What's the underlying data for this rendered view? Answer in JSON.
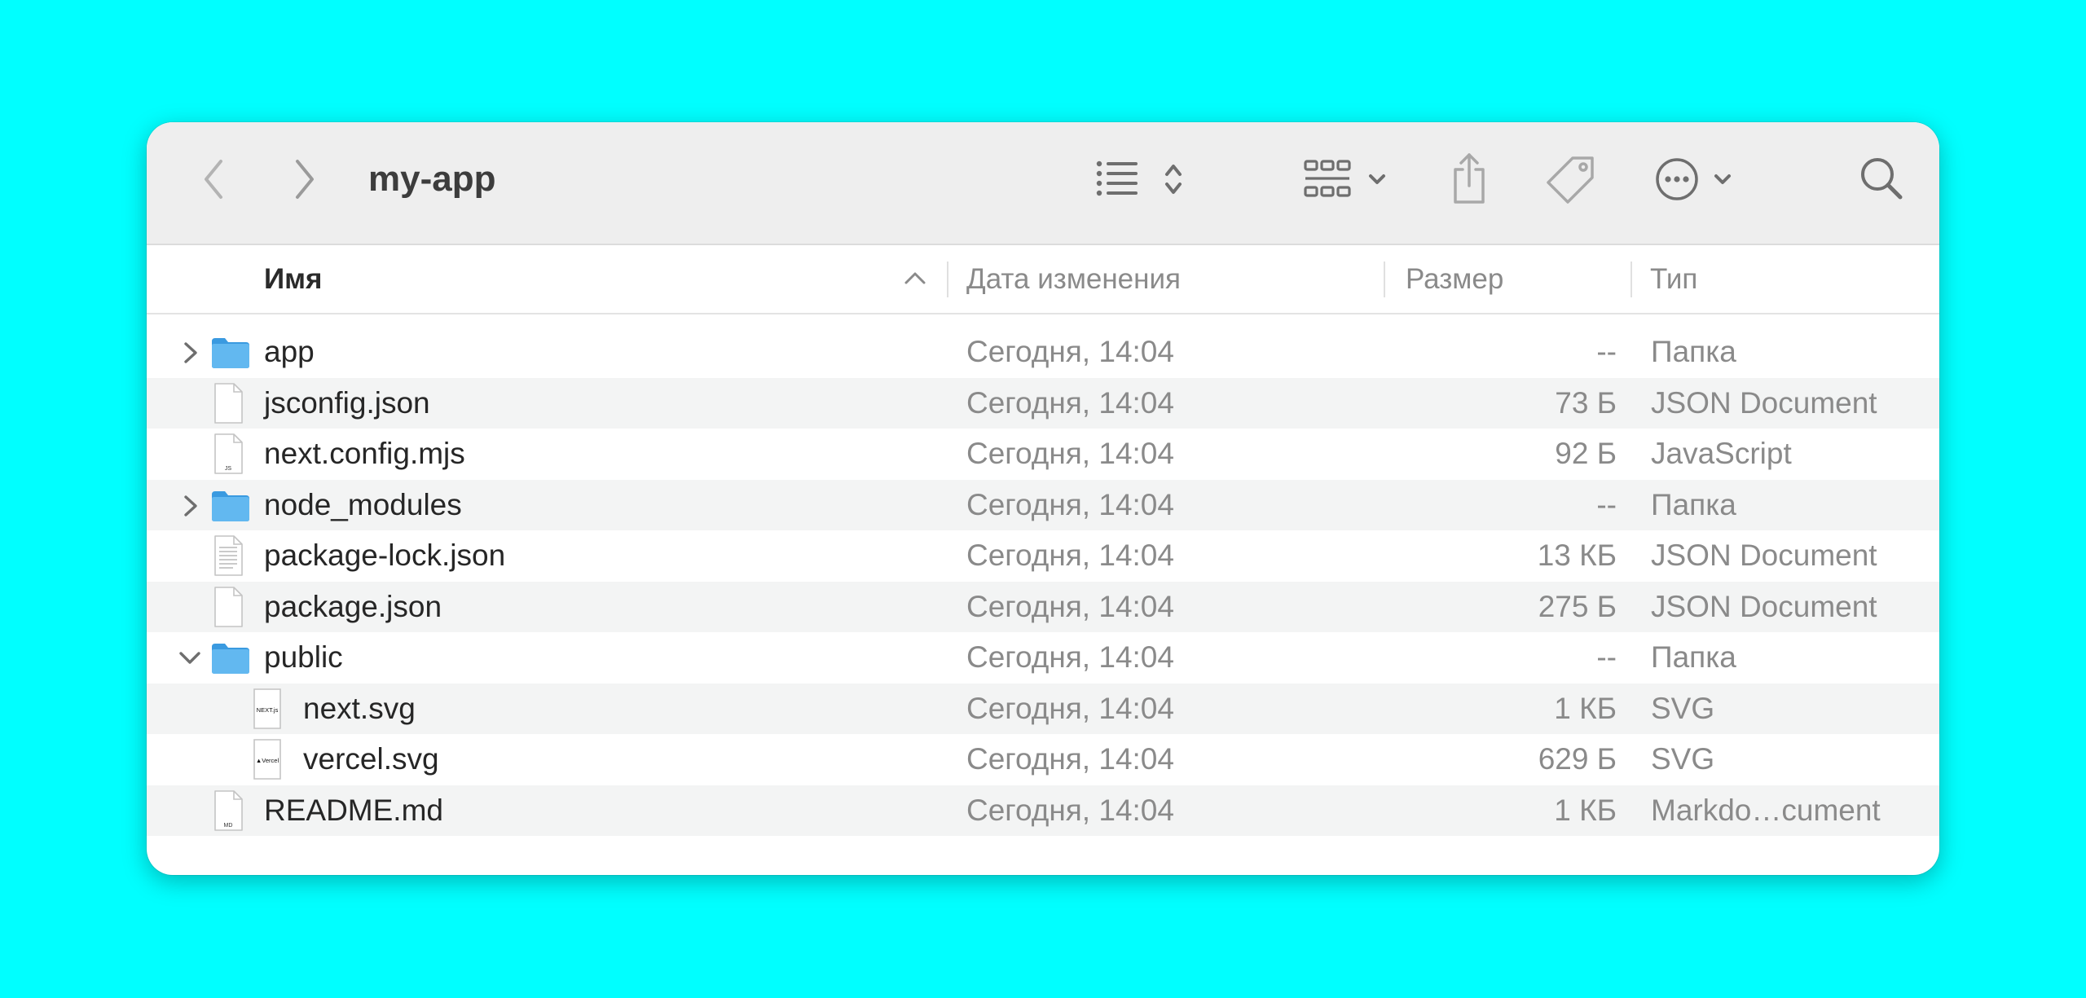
{
  "window": {
    "title": "my-app"
  },
  "toolbar": {
    "back_icon": "chevron-left-icon",
    "forward_icon": "chevron-right-icon",
    "view_icon": "list-view-icon",
    "group_icon": "grid-group-icon",
    "share_icon": "share-icon",
    "tag_icon": "tag-icon",
    "more_icon": "ellipsis-circle-icon",
    "search_icon": "search-icon"
  },
  "columns": {
    "name": "Имя",
    "date": "Дата изменения",
    "size": "Размер",
    "kind": "Тип",
    "sort": "ascending"
  },
  "files": [
    {
      "name": "app",
      "date": "Сегодня, 14:04",
      "size": "--",
      "kind": "Папка",
      "icon": "folder-icon",
      "disclosure": "collapsed"
    },
    {
      "name": "jsconfig.json",
      "date": "Сегодня, 14:04",
      "size": "73 Б",
      "kind": "JSON Document",
      "icon": "document-icon"
    },
    {
      "name": "next.config.mjs",
      "date": "Сегодня, 14:04",
      "size": "92 Б",
      "kind": "JavaScript",
      "icon": "js-file-icon",
      "icon_label": "JS"
    },
    {
      "name": "node_modules",
      "date": "Сегодня, 14:04",
      "size": "--",
      "kind": "Папка",
      "icon": "folder-icon",
      "disclosure": "collapsed"
    },
    {
      "name": "package-lock.json",
      "date": "Сегодня, 14:04",
      "size": "13 КБ",
      "kind": "JSON Document",
      "icon": "text-document-icon"
    },
    {
      "name": "package.json",
      "date": "Сегодня, 14:04",
      "size": "275 Б",
      "kind": "JSON Document",
      "icon": "document-icon"
    },
    {
      "name": "public",
      "date": "Сегодня, 14:04",
      "size": "--",
      "kind": "Папка",
      "icon": "folder-icon",
      "disclosure": "expanded"
    },
    {
      "name": "next.svg",
      "date": "Сегодня, 14:04",
      "size": "1 КБ",
      "kind": "SVG",
      "icon": "svg-file-icon",
      "icon_label": "NEXT.js",
      "indent": 1
    },
    {
      "name": "vercel.svg",
      "date": "Сегодня, 14:04",
      "size": "629 Б",
      "kind": "SVG",
      "icon": "svg-file-icon",
      "icon_label": "▲Vercel",
      "indent": 1
    },
    {
      "name": "README.md",
      "date": "Сегодня, 14:04",
      "size": "1 КБ",
      "kind": "Markdo…cument",
      "icon": "md-file-icon",
      "icon_label": "MD"
    }
  ]
}
